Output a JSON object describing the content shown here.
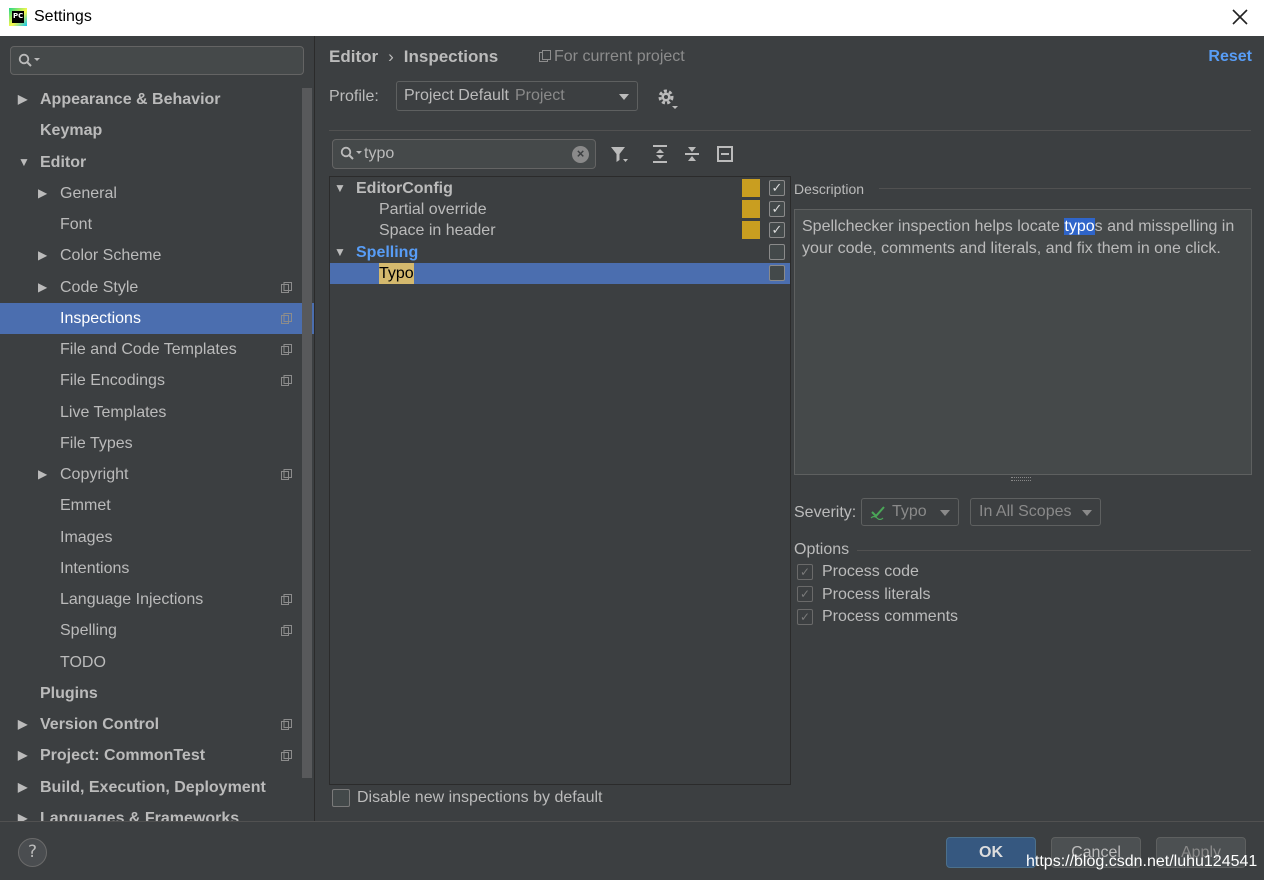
{
  "window": {
    "title": "Settings",
    "app_icon_text": "PC"
  },
  "sidebar": {
    "items": [
      {
        "label": "Appearance & Behavior",
        "bold": true,
        "arrow": "right",
        "copy": false
      },
      {
        "label": "Keymap",
        "bold": true,
        "arrow": "",
        "copy": false
      },
      {
        "label": "Editor",
        "bold": true,
        "arrow": "down",
        "copy": false
      },
      {
        "label": "General",
        "bold": false,
        "arrow": "right",
        "copy": false
      },
      {
        "label": "Font",
        "bold": false,
        "arrow": "",
        "copy": false
      },
      {
        "label": "Color Scheme",
        "bold": false,
        "arrow": "right",
        "copy": false
      },
      {
        "label": "Code Style",
        "bold": false,
        "arrow": "right",
        "copy": true
      },
      {
        "label": "Inspections",
        "bold": false,
        "arrow": "",
        "copy": true,
        "selected": true
      },
      {
        "label": "File and Code Templates",
        "bold": false,
        "arrow": "",
        "copy": true
      },
      {
        "label": "File Encodings",
        "bold": false,
        "arrow": "",
        "copy": true
      },
      {
        "label": "Live Templates",
        "bold": false,
        "arrow": "",
        "copy": false
      },
      {
        "label": "File Types",
        "bold": false,
        "arrow": "",
        "copy": false
      },
      {
        "label": "Copyright",
        "bold": false,
        "arrow": "right",
        "copy": true
      },
      {
        "label": "Emmet",
        "bold": false,
        "arrow": "",
        "copy": false
      },
      {
        "label": "Images",
        "bold": false,
        "arrow": "",
        "copy": false
      },
      {
        "label": "Intentions",
        "bold": false,
        "arrow": "",
        "copy": false
      },
      {
        "label": "Language Injections",
        "bold": false,
        "arrow": "",
        "copy": true
      },
      {
        "label": "Spelling",
        "bold": false,
        "arrow": "",
        "copy": true
      },
      {
        "label": "TODO",
        "bold": false,
        "arrow": "",
        "copy": false
      },
      {
        "label": "Plugins",
        "bold": true,
        "arrow": "",
        "copy": false
      },
      {
        "label": "Version Control",
        "bold": true,
        "arrow": "right",
        "copy": true
      },
      {
        "label": "Project: CommonTest",
        "bold": true,
        "arrow": "right",
        "copy": true
      },
      {
        "label": "Build, Execution, Deployment",
        "bold": true,
        "arrow": "right",
        "copy": false
      },
      {
        "label": "Languages & Frameworks",
        "bold": true,
        "arrow": "right",
        "copy": false
      }
    ]
  },
  "header": {
    "crumb_1": "Editor",
    "crumb_sep": "›",
    "crumb_2": "Inspections",
    "for_project": "For current project",
    "reset": "Reset"
  },
  "profile": {
    "label": "Profile:",
    "value": "Project Default",
    "scope": "Project"
  },
  "filter": {
    "value": "typo"
  },
  "tree": {
    "rows": [
      {
        "label": "EditorConfig",
        "kind": "group",
        "expanded": true,
        "color": "#bbbbbb",
        "severity": true,
        "checked": true
      },
      {
        "label": "Partial override",
        "kind": "item",
        "severity": true,
        "checked": true
      },
      {
        "label": "Space in header",
        "kind": "item",
        "severity": true,
        "checked": true
      },
      {
        "label": "Spelling",
        "kind": "group",
        "expanded": true,
        "color": "#589df6",
        "severity": false,
        "checked": false
      },
      {
        "label": "Typo",
        "kind": "item",
        "severity": false,
        "checked": false,
        "selected": true
      }
    ]
  },
  "description": {
    "label": "Description",
    "text_before": "Spellchecker inspection helps locate ",
    "highlight": "typo",
    "text_after": "s and misspelling in your code, comments and literals, and fix them in one click."
  },
  "severity": {
    "label": "Severity:",
    "value": "Typo",
    "scope": "In All Scopes"
  },
  "options": {
    "title": "Options",
    "items": [
      {
        "label": "Process code",
        "checked": true
      },
      {
        "label": "Process literals",
        "checked": true
      },
      {
        "label": "Process comments",
        "checked": true
      }
    ]
  },
  "disable_new": {
    "label": "Disable new inspections by default",
    "checked": false
  },
  "buttons": {
    "ok": "OK",
    "cancel": "Cancel",
    "apply": "Apply",
    "help": "?"
  },
  "watermark": "https://blog.csdn.net/luhu124541",
  "colors": {
    "accent": "#4b6eaf",
    "severity_typo": "#c99e20",
    "link": "#589df6",
    "ok_button": "#365880"
  }
}
